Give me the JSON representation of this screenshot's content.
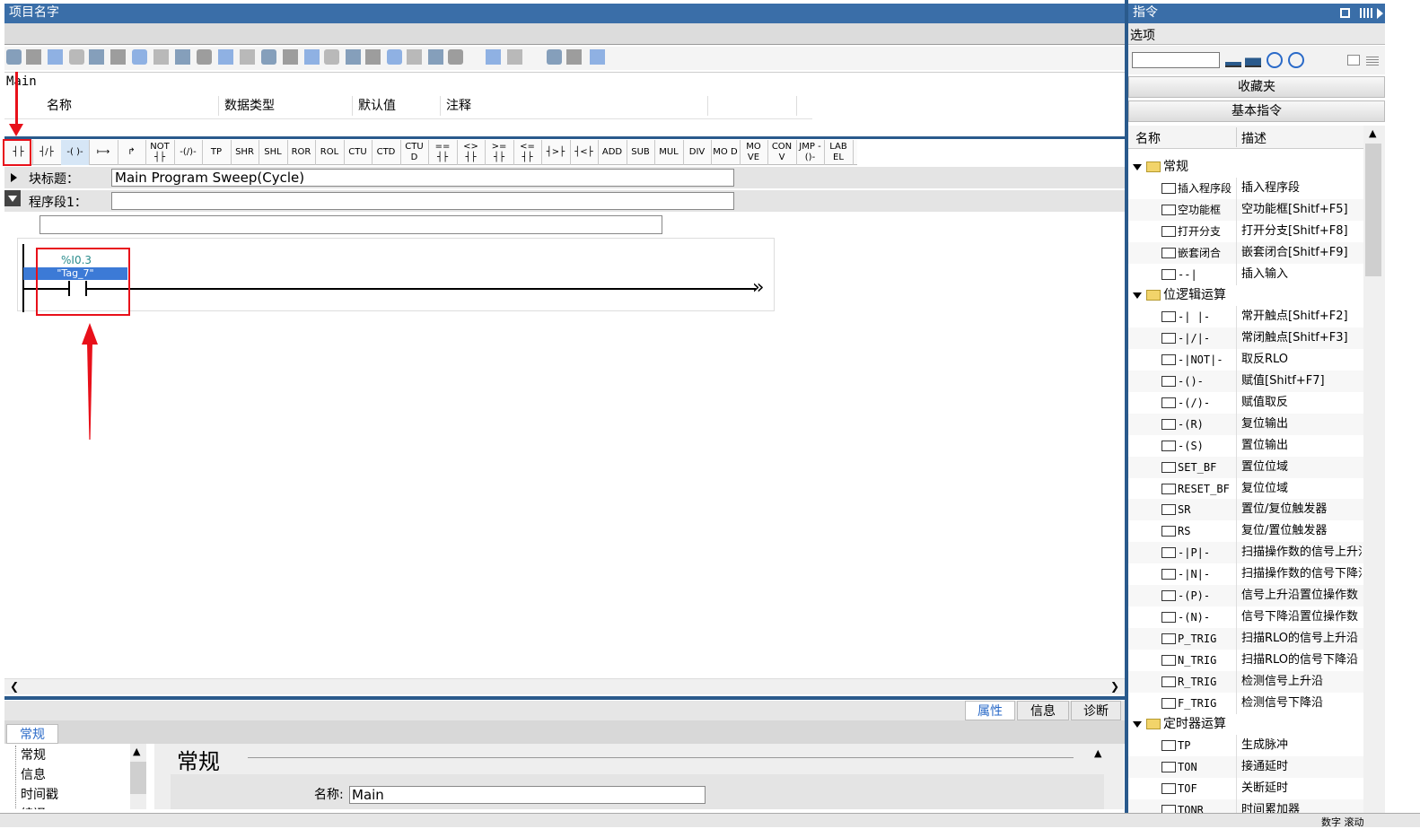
{
  "editor": {
    "title": "项目名字",
    "block_name": "Main",
    "interface_headers": [
      "名称",
      "数据类型",
      "默认值",
      "注释"
    ],
    "ladder_buttons": [
      "┤├",
      "┤/├",
      "-( )-",
      "⟼",
      "↱",
      "NOT ┤├",
      "-(/)-",
      "TP",
      "SHR",
      "SHL",
      "ROR",
      "ROL",
      "CTU",
      "CTD",
      "CTU D",
      "== ┤├",
      "<> ┤├",
      ">= ┤├",
      "<= ┤├",
      "┤>├",
      "┤<├",
      "ADD",
      "SUB",
      "MUL",
      "DIV",
      "MO D",
      "MO VE",
      "CON V",
      "JMP -()-",
      "LAB EL"
    ],
    "block_title_label": "块标题：",
    "block_title_value": "Main Program Sweep(Cycle)",
    "network_label": "程序段1：",
    "network_value": "",
    "contact": {
      "address": "%I0.3",
      "tag": "\"Tag_7\""
    }
  },
  "properties": {
    "tabs": [
      "属性",
      "信息",
      "诊断"
    ],
    "active_tab": "常规",
    "nav_items": [
      "常规",
      "信息",
      "时间戳",
      "编译"
    ],
    "section_title": "常规",
    "name_label": "名称:",
    "name_value": "Main"
  },
  "instructions": {
    "title": "指令",
    "options_label": "选项",
    "favorites_label": "收藏夹",
    "basic_label": "基本指令",
    "col_name": "名称",
    "col_desc": "描述",
    "rows": [
      {
        "type": "folder",
        "name": "常规",
        "desc": ""
      },
      {
        "type": "item",
        "name": "插入程序段",
        "desc": "插入程序段"
      },
      {
        "type": "item",
        "name": "空功能框",
        "desc": "空功能框[Shitf+F5]"
      },
      {
        "type": "item",
        "name": "打开分支",
        "desc": "打开分支[Shitf+F8]"
      },
      {
        "type": "item",
        "name": "嵌套闭合",
        "desc": "嵌套闭合[Shitf+F9]"
      },
      {
        "type": "item",
        "name": "--|",
        "desc": "插入输入"
      },
      {
        "type": "folder",
        "name": "位逻辑运算",
        "desc": ""
      },
      {
        "type": "item",
        "name": "-| |-",
        "desc": "常开触点[Shitf+F2]"
      },
      {
        "type": "item",
        "name": "-|/|-",
        "desc": "常闭触点[Shitf+F3]"
      },
      {
        "type": "item",
        "name": "-|NOT|-",
        "desc": "取反RLO"
      },
      {
        "type": "item",
        "name": "-()-",
        "desc": "赋值[Shitf+F7]"
      },
      {
        "type": "item",
        "name": "-(/)-",
        "desc": "赋值取反"
      },
      {
        "type": "item",
        "name": "-(R)",
        "desc": "复位输出"
      },
      {
        "type": "item",
        "name": "-(S)",
        "desc": "置位输出"
      },
      {
        "type": "item",
        "name": "SET_BF",
        "desc": "置位位域"
      },
      {
        "type": "item",
        "name": "RESET_BF",
        "desc": "复位位域"
      },
      {
        "type": "item",
        "name": "SR",
        "desc": "置位/复位触发器"
      },
      {
        "type": "item",
        "name": "RS",
        "desc": "复位/置位触发器"
      },
      {
        "type": "item",
        "name": "-|P|-",
        "desc": "扫描操作数的信号上升沿"
      },
      {
        "type": "item",
        "name": "-|N|-",
        "desc": "扫描操作数的信号下降沿"
      },
      {
        "type": "item",
        "name": "-(P)-",
        "desc": "信号上升沿置位操作数"
      },
      {
        "type": "item",
        "name": "-(N)-",
        "desc": "信号下降沿置位操作数"
      },
      {
        "type": "item",
        "name": "P_TRIG",
        "desc": "扫描RLO的信号上升沿"
      },
      {
        "type": "item",
        "name": "N_TRIG",
        "desc": "扫描RLO的信号下降沿"
      },
      {
        "type": "item",
        "name": "R_TRIG",
        "desc": "检测信号上升沿"
      },
      {
        "type": "item",
        "name": "F_TRIG",
        "desc": "检测信号下降沿"
      },
      {
        "type": "folder",
        "name": "定时器运算",
        "desc": ""
      },
      {
        "type": "item",
        "name": "TP",
        "desc": "生成脉冲"
      },
      {
        "type": "item",
        "name": "TON",
        "desc": "接通延时"
      },
      {
        "type": "item",
        "name": "TOF",
        "desc": "关断延时"
      },
      {
        "type": "item",
        "name": "TONR",
        "desc": "时间累加器"
      }
    ]
  },
  "status": {
    "right": "数字  滚动"
  },
  "colors": {
    "accent": "#3a6ea8",
    "highlight": "#e8101a",
    "selection": "#3c7ad6"
  }
}
